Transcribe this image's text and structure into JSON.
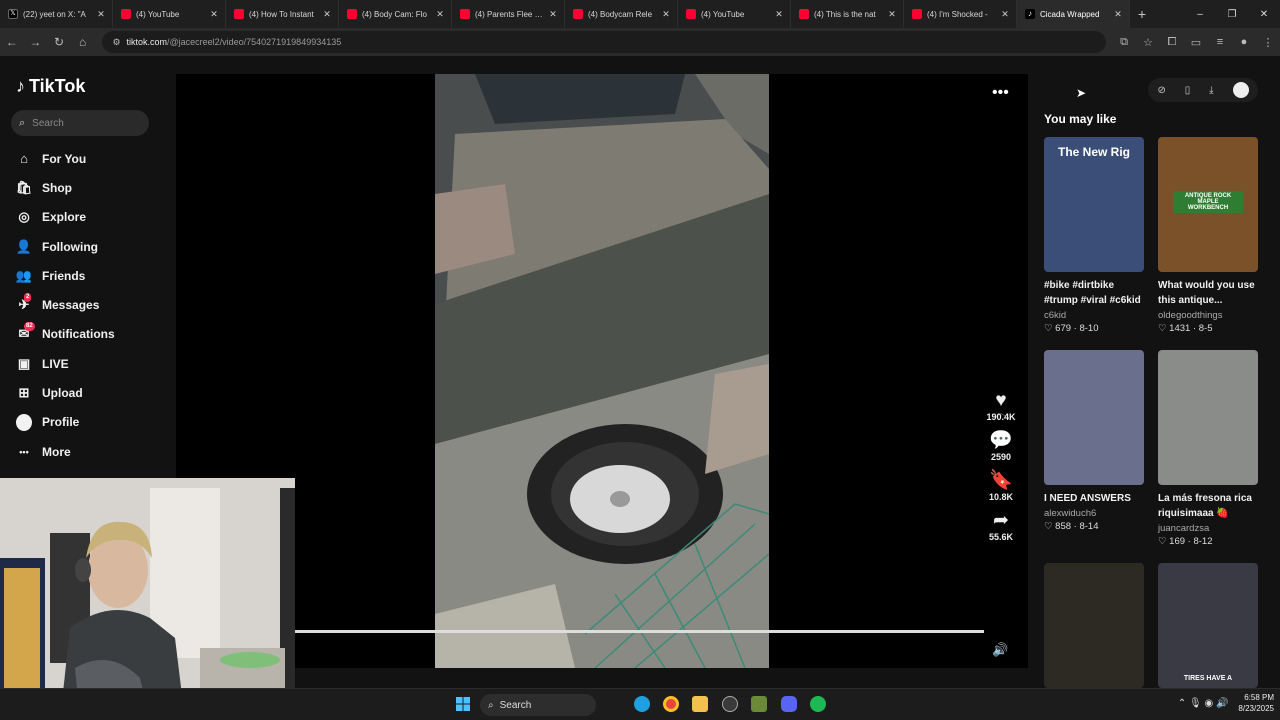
{
  "browser": {
    "tabs": [
      {
        "label": "(22) yeet on X: \"A",
        "icon": "x-favicon",
        "active": false
      },
      {
        "label": "(4) YouTube",
        "icon": "youtube-favicon",
        "active": false
      },
      {
        "label": "(4) How To Instant",
        "icon": "youtube-favicon",
        "active": false
      },
      {
        "label": "(4) Body Cam: Flo",
        "icon": "youtube-favicon",
        "active": false
      },
      {
        "label": "(4) Parents Flee Po",
        "icon": "youtube-favicon",
        "active": false
      },
      {
        "label": "(4) Bodycam Rele",
        "icon": "youtube-favicon",
        "active": false
      },
      {
        "label": "(4) YouTube",
        "icon": "youtube-favicon",
        "active": false
      },
      {
        "label": "(4) This is the nat",
        "icon": "youtube-favicon",
        "active": false
      },
      {
        "label": "(4) I'm Shocked -",
        "icon": "youtube-favicon",
        "active": false
      },
      {
        "label": "Cicada Wrapped",
        "icon": "tiktok-favicon",
        "active": true
      }
    ],
    "new_tab": "+",
    "window_controls": {
      "minimize": "–",
      "restore": "❐",
      "close": "✕"
    },
    "url_domain": "tiktok.com",
    "url_path": "/@jacecreel2/video/7540271919849934135"
  },
  "sidebar": {
    "logo": "TikTok",
    "search_placeholder": "Search",
    "items": [
      {
        "label": "For You",
        "icon": "home-icon",
        "glyph": "⌂"
      },
      {
        "label": "Shop",
        "icon": "shopping-bag-icon",
        "glyph": "🛍"
      },
      {
        "label": "Explore",
        "icon": "compass-icon",
        "glyph": "◎"
      },
      {
        "label": "Following",
        "icon": "following-icon",
        "glyph": "👤"
      },
      {
        "label": "Friends",
        "icon": "friends-icon",
        "glyph": "👥"
      },
      {
        "label": "Messages",
        "icon": "paper-plane-icon",
        "glyph": "✈",
        "badge": "2"
      },
      {
        "label": "Notifications",
        "icon": "inbox-icon",
        "glyph": "✉",
        "badge": "82"
      },
      {
        "label": "LIVE",
        "icon": "live-icon",
        "glyph": "▣"
      },
      {
        "label": "Upload",
        "icon": "plus-square-icon",
        "glyph": "⊞"
      },
      {
        "label": "Profile",
        "icon": "avatar-icon",
        "glyph": ""
      },
      {
        "label": "More",
        "icon": "more-icon",
        "glyph": "•••"
      }
    ]
  },
  "video": {
    "actions": [
      {
        "name": "like",
        "icon": "heart-icon",
        "glyph": "♥",
        "count": "190.4K"
      },
      {
        "name": "comment",
        "icon": "comment-icon",
        "glyph": "💬",
        "count": "2590"
      },
      {
        "name": "save",
        "icon": "bookmark-icon",
        "glyph": "🔖",
        "count": "10.8K"
      },
      {
        "name": "share",
        "icon": "share-icon",
        "glyph": "➦",
        "count": "55.6K"
      }
    ],
    "more_glyph": "•••",
    "progress": 0.97,
    "volume_glyph": "🔊"
  },
  "right_panel": {
    "heading": "You may like",
    "cards": [
      {
        "title": "#bike #dirtbike #trump #viral #c6kid",
        "user": "c6kid",
        "likes": "679",
        "date": "8-10",
        "thumb_text": "The New Rig",
        "thumb_color": "#3a4e78"
      },
      {
        "title": "What would you use this antique...",
        "user": "oldegoodthings",
        "likes": "1431",
        "date": "8-5",
        "thumb_text": "ANTIQUE ROCK MAPLE WORKBENCH",
        "thumb_color": "#7a5128"
      },
      {
        "title": "I NEED ANSWERS",
        "user": "alexwiduch6",
        "likes": "858",
        "date": "8-14",
        "thumb_text": "",
        "thumb_color": "#6b6f8e"
      },
      {
        "title": "La más fresona rica riquisimaaa 🍓",
        "user": "juancardzsa",
        "likes": "169",
        "date": "8-12",
        "thumb_text": "",
        "thumb_color": "#8a8c8a"
      },
      {
        "title": "",
        "user": "",
        "likes": "",
        "date": "",
        "thumb_text": "",
        "thumb_color": "#2c2a22"
      },
      {
        "title": "",
        "user": "",
        "likes": "",
        "date": "",
        "thumb_text": "TIRES HAVE A",
        "thumb_color": "#3a3a44"
      }
    ]
  },
  "taskbar": {
    "search_label": "Search",
    "time": "6:58 PM",
    "date": "8/23/2025"
  },
  "colors": {
    "accent": "#fe2c55",
    "background": "#121212"
  }
}
